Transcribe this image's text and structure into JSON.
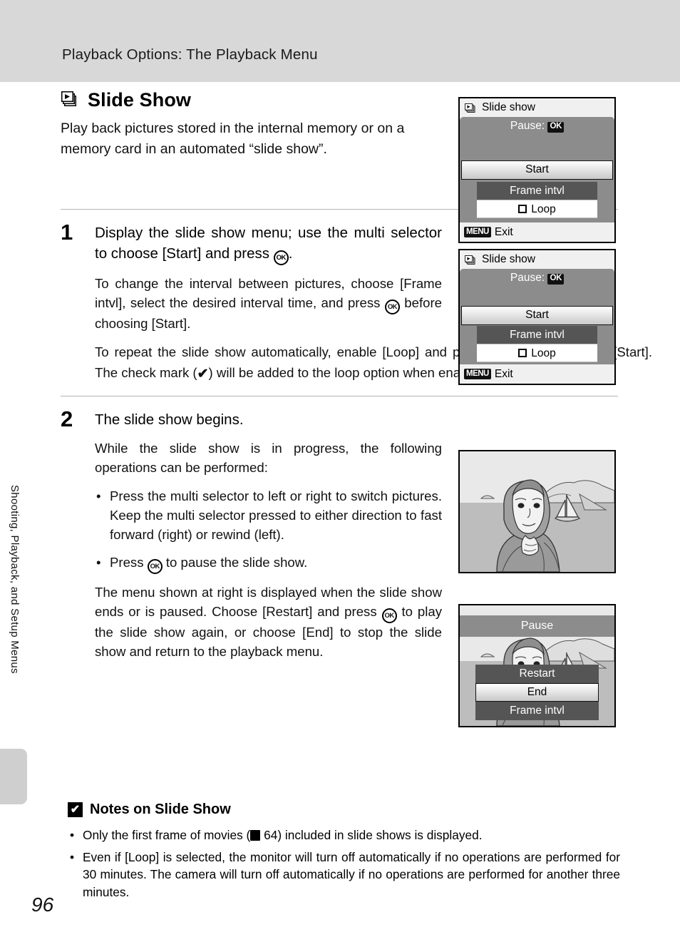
{
  "header": {
    "running_title": "Playback Options: The Playback Menu"
  },
  "sidebar": {
    "vertical_label": "Shooting, Playback, and Setup Menus",
    "page_number": "96"
  },
  "section": {
    "icon": "slide-show-icon",
    "title": "Slide Show",
    "intro": "Play back pictures stored in the internal memory or on a memory card in an automated “slide show”."
  },
  "steps": [
    {
      "number": "1",
      "lead_part1": "Display the slide show menu; use the multi selector to choose [Start] and press ",
      "lead_part2": ".",
      "para1_part1": "To change the interval between pictures, choose [Frame intvl], select the desired interval time, and press ",
      "para1_part2": " before choosing [Start].",
      "para2_part1": "To repeat the slide show automatically, enable [Loop] and press ",
      "para2_part2": " before choosing [Start]. The check mark (",
      "para2_part3": ") will be added to the loop option when enabled."
    },
    {
      "number": "2",
      "lead": "The slide show begins.",
      "para1": "While the slide show is in progress, the following operations can be performed:",
      "bullet1": "Press the multi selector to left or right to switch pictures. Keep the multi selector pressed to either direction to fast forward (right) or rewind (left).",
      "bullet2_part1": "Press ",
      "bullet2_part2": " to pause the slide show.",
      "para2_part1": "The menu shown at right is displayed when the slide show ends or is paused. Choose [Restart] and press ",
      "para2_part2": " to play the slide show again, or choose [End] to stop the slide show and return to the playback menu."
    }
  ],
  "lcd_menu": {
    "title": "Slide show",
    "pause_label": "Pause:",
    "pause_badge": "OK",
    "item_start": "Start",
    "item_frame_intvl": "Frame intvl",
    "item_loop": "Loop",
    "footer_badge": "MENU",
    "footer_label": "Exit"
  },
  "pause_menu": {
    "title": "Pause",
    "item_restart": "Restart",
    "item_end": "End",
    "item_frame_intvl": "Frame intvl"
  },
  "notes": {
    "icon": "check-box-icon",
    "title": "Notes on Slide Show",
    "item1_part1": "Only the first frame of movies (",
    "item1_ref": "64",
    "item1_part2": ") included in slide shows is displayed.",
    "item2": "Even if [Loop] is selected, the monitor will turn off automatically if no operations are performed for 30 minutes. The camera will turn off automatically if no operations are performed for another three minutes."
  },
  "glyphs": {
    "ok": "OK",
    "checkmark": "✔"
  },
  "colors": {
    "header_band": "#d8d8d8",
    "lcd_gray": "#8c8c8c",
    "lcd_dark_row": "#555555",
    "side_tab": "#cfcfcf"
  }
}
